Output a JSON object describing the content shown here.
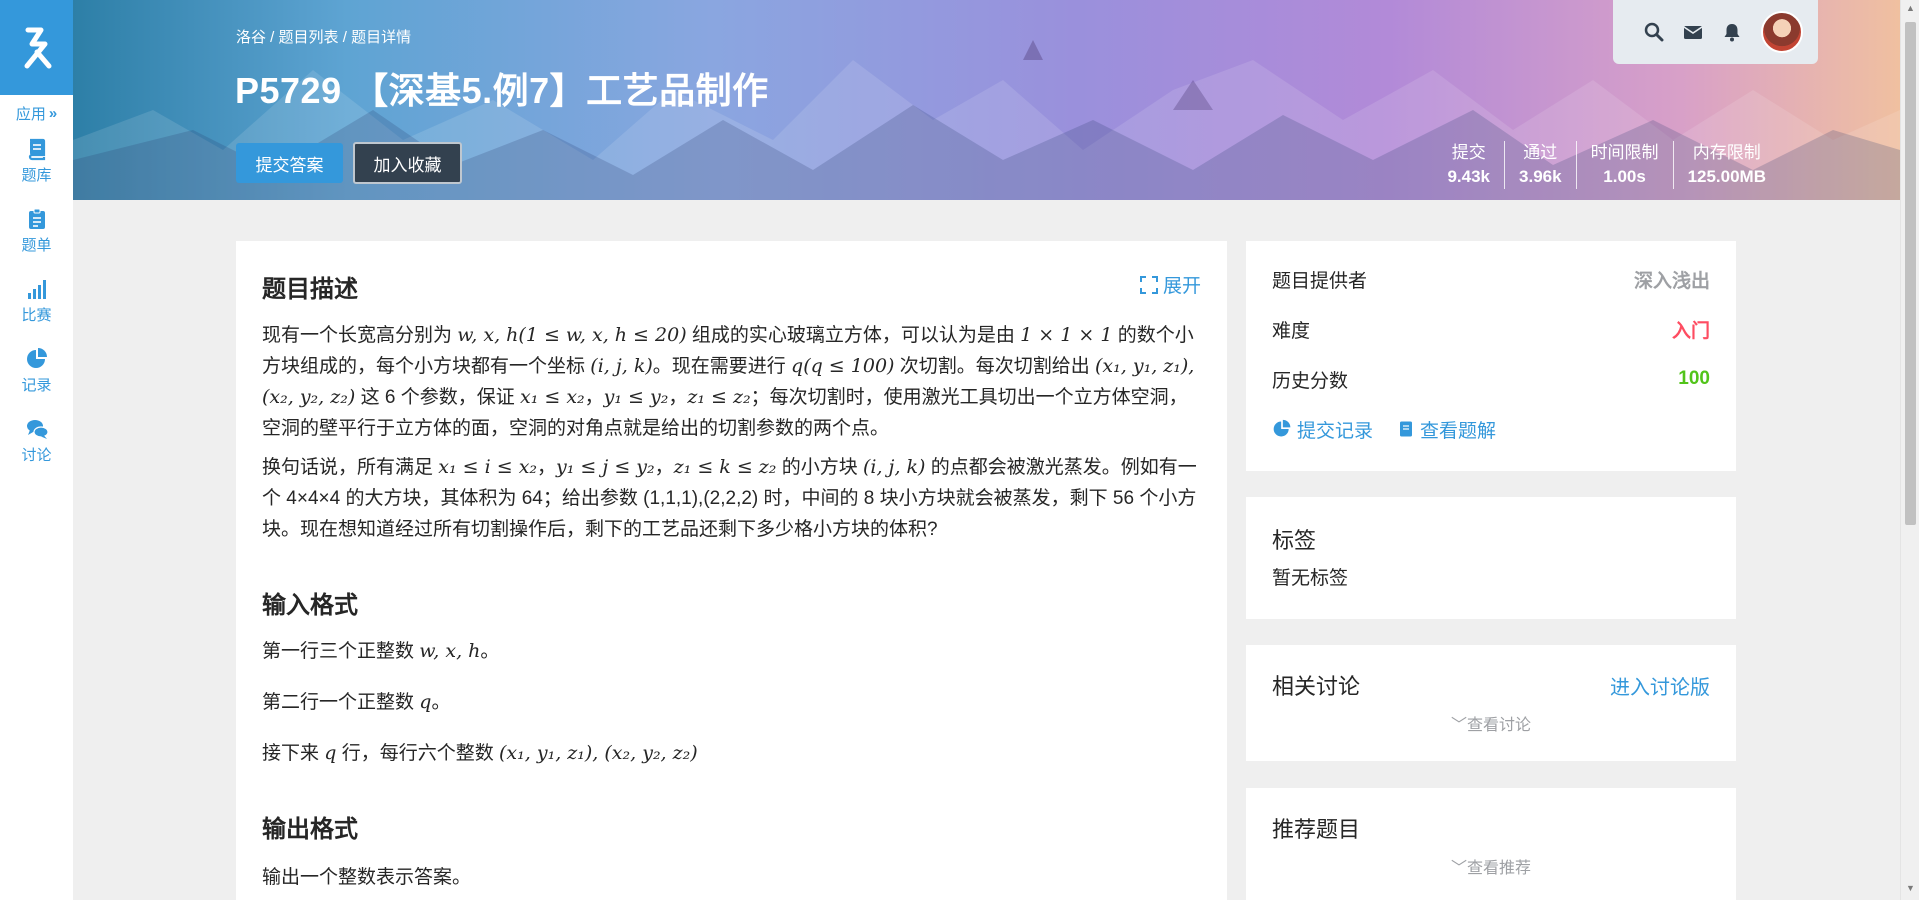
{
  "sidebar": {
    "apps_label": "应用",
    "items": [
      {
        "label": "题库",
        "icon": "book-icon"
      },
      {
        "label": "题单",
        "icon": "clipboard-list-icon"
      },
      {
        "label": "比赛",
        "icon": "signal-bars-icon"
      },
      {
        "label": "记录",
        "icon": "pie-chart-icon"
      },
      {
        "label": "讨论",
        "icon": "comments-icon"
      }
    ]
  },
  "header": {
    "breadcrumb": [
      "洛谷",
      "题目列表",
      "题目详情"
    ],
    "breadcrumb_sep": " / ",
    "title": "P5729 【深基5.例7】工艺品制作",
    "submit_label": "提交答案",
    "favorite_label": "加入收藏",
    "stats": [
      {
        "label": "提交",
        "value": "9.43k"
      },
      {
        "label": "通过",
        "value": "3.96k"
      },
      {
        "label": "时间限制",
        "value": "1.00s"
      },
      {
        "label": "内存限制",
        "value": "125.00MB"
      }
    ]
  },
  "topbar": {
    "icons": [
      "search-icon",
      "envelope-icon",
      "bell-icon"
    ]
  },
  "problem": {
    "desc_title": "题目描述",
    "expand_label": "展开",
    "desc_p1": [
      {
        "t": "现有一个长宽高分别为 "
      },
      {
        "m": "w, x, h(1 ≤ w, x, h ≤ 20)"
      },
      {
        "t": " 组成的实心玻璃立方体，可以认为是由 "
      },
      {
        "m": "1 × 1 × 1"
      },
      {
        "t": " 的数个小方块组成的，每个小方块都有一个坐标 "
      },
      {
        "m": "(i, j, k)"
      },
      {
        "t": "。现在需要进行 "
      },
      {
        "m": "q(q ≤ 100)"
      },
      {
        "t": " 次切割。每次切割给出 "
      },
      {
        "m": "(x₁, y₁, z₁), (x₂, y₂, z₂)"
      },
      {
        "t": " 这 6 个参数，保证 "
      },
      {
        "m": "x₁ ≤ x₂"
      },
      {
        "t": "，"
      },
      {
        "m": "y₁ ≤ y₂"
      },
      {
        "t": "，"
      },
      {
        "m": "z₁ ≤ z₂"
      },
      {
        "t": "；每次切割时，使用激光工具切出一个立方体空洞，空洞的壁平行于立方体的面，空洞的对角点就是给出的切割参数的两个点。"
      }
    ],
    "desc_p2": [
      {
        "t": "换句话说，所有满足 "
      },
      {
        "m": "x₁ ≤ i ≤ x₂"
      },
      {
        "t": "，"
      },
      {
        "m": "y₁ ≤ j ≤ y₂"
      },
      {
        "t": "，"
      },
      {
        "m": "z₁ ≤ k ≤ z₂"
      },
      {
        "t": " 的小方块 "
      },
      {
        "m": "(i, j, k)"
      },
      {
        "t": " 的点都会被激光蒸发。例如有一个 4×4×4 的大方块，其体积为 64；给出参数 (1,1,1),(2,2,2) 时，中间的 8 块小方块就会被蒸发，剩下 56 个小方块。现在想知道经过所有切割操作后，剩下的工艺品还剩下多少格小方块的体积?"
      }
    ],
    "input_title": "输入格式",
    "input_lines": [
      [
        {
          "t": "第一行三个正整数 "
        },
        {
          "m": "w, x, h"
        },
        {
          "t": "。"
        }
      ],
      [
        {
          "t": "第二行一个正整数 "
        },
        {
          "m": "q"
        },
        {
          "t": "。"
        }
      ],
      [
        {
          "t": "接下来 "
        },
        {
          "m": "q"
        },
        {
          "t": " 行，每行六个整数 "
        },
        {
          "m": "(x₁, y₁, z₁), (x₂, y₂, z₂)"
        }
      ]
    ],
    "output_title": "输出格式",
    "output_line": "输出一个整数表示答案。"
  },
  "info": {
    "provider_label": "题目提供者",
    "provider_value": "深入浅出",
    "difficulty_label": "难度",
    "difficulty_value": "入门",
    "score_label": "历史分数",
    "score_value": "100",
    "records_link": "提交记录",
    "solution_link": "查看题解"
  },
  "tags": {
    "title": "标签",
    "empty": "暂无标签"
  },
  "discuss": {
    "title": "相关讨论",
    "link": "进入讨论版",
    "toggle": "查看讨论"
  },
  "recommend": {
    "title": "推荐题目",
    "toggle": "查看推荐"
  },
  "colors": {
    "accent": "#3498db",
    "difficulty_red": "#fe4c61",
    "score_green": "#52c41a"
  }
}
